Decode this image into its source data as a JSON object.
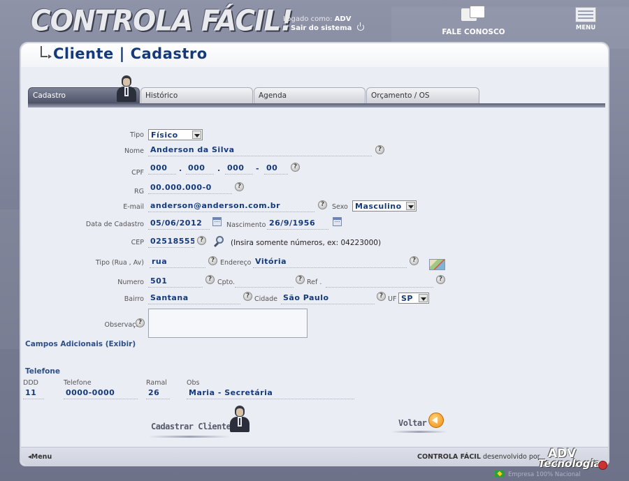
{
  "header": {
    "logo_text": "CONTROLA FÁCIL!",
    "logged_as_label": "Logado como:",
    "logged_user": "ADV",
    "logout_label": "Sair do sistema",
    "contact_label": "FALE CONOSCO",
    "menu_label": "MENU"
  },
  "page": {
    "title": "Cliente | Cadastro"
  },
  "tabs": [
    {
      "label": "Cadastro",
      "active": true
    },
    {
      "label": "Histórico",
      "active": false
    },
    {
      "label": "Agenda",
      "active": false
    },
    {
      "label": "Orçamento / OS",
      "active": false
    }
  ],
  "form": {
    "tipo": {
      "label": "Tipo",
      "value": "Físico"
    },
    "nome": {
      "label": "Nome",
      "value": "Anderson da Silva"
    },
    "cpf": {
      "label": "CPF",
      "parts": [
        "000",
        "000",
        "000",
        "00"
      ],
      "sep1": ".",
      "sep2": ".",
      "sep3": "-"
    },
    "rg": {
      "label": "RG",
      "value": "00.000.000-0"
    },
    "email": {
      "label": "E-mail",
      "value": "anderson@anderson.com.br"
    },
    "sexo": {
      "label": "Sexo",
      "value": "Masculino"
    },
    "data_cadastro": {
      "label": "Data de Cadastro",
      "value": "05/06/2012"
    },
    "nascimento": {
      "label": "Nascimento",
      "value": "26/9/1956"
    },
    "cep": {
      "label": "CEP",
      "value": "02518555",
      "hint": "(Insira somente números, ex: 04223000)"
    },
    "tipo_logradouro": {
      "label": "Tipo (Rua , Av)",
      "value": "rua"
    },
    "endereco": {
      "label": "Endereço",
      "value": "Vitória"
    },
    "numero": {
      "label": "Numero",
      "value": "501"
    },
    "complemento": {
      "label": "Cpto.",
      "value": ""
    },
    "referencia": {
      "label": "Ref .",
      "value": ""
    },
    "bairro": {
      "label": "Bairro",
      "value": "Santana"
    },
    "cidade": {
      "label": "Cidade",
      "value": "São Paulo"
    },
    "uf": {
      "label": "UF",
      "value": "SP"
    },
    "observacao": {
      "label": "Observação",
      "value": ""
    },
    "help_glyph": "?"
  },
  "sections": {
    "campos_adicionais": "Campos Adicionais (Exibir)",
    "telefone": "Telefone"
  },
  "phone_table": {
    "headers": [
      "DDD",
      "Telefone",
      "Ramal",
      "Obs"
    ],
    "rows": [
      [
        "11",
        "0000-0000",
        "26",
        "Maria - Secretária"
      ]
    ]
  },
  "actions": {
    "submit_label": "Cadastrar Cliente",
    "back_label": "Voltar"
  },
  "footer": {
    "menu_label": "Menu",
    "brand": "CONTROLA FÁCIL",
    "developed_by": "desenvolvido por",
    "company_line1": "ADV",
    "company_line2": "Tecnologia",
    "national_label": "Empresa 100% Nacional"
  },
  "colors": {
    "accent": "#153a7a",
    "background": "#7f8399",
    "panel": "#ebedf5",
    "tab_active": "#4c5066"
  },
  "icons": [
    "power-icon",
    "chat-icon",
    "menu-icon",
    "user-avatar-icon",
    "help-icon",
    "calendar-icon",
    "search-icon",
    "map-icon",
    "back-arrow-icon",
    "flag-icon"
  ]
}
